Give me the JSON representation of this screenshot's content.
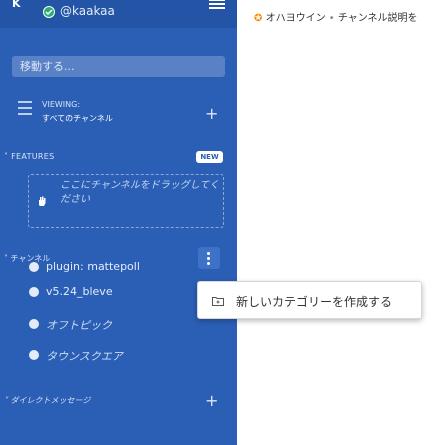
{
  "header": {
    "team_glyph": "K",
    "username": "@kaakaa",
    "channel_title": "オハヨウイン",
    "separator": "•",
    "channel_purpose": "チャンネル説明を"
  },
  "search": {
    "placeholder": "移動する..."
  },
  "viewing": {
    "label": "VIEWING:",
    "value": "すべてのチャンネル",
    "add_label": "+"
  },
  "features": {
    "title": "FEATURES",
    "badge": "NEW",
    "notice": "ここにチャンネルをドラッグしてください"
  },
  "channels": {
    "title": "チャンネル",
    "items": [
      {
        "label": "plugin: mattepoll",
        "italic": false
      },
      {
        "label": "v5.24_bleve",
        "italic": false
      },
      {
        "label": "オフトピック",
        "italic": true
      },
      {
        "label": "タウンスクエア",
        "italic": true
      }
    ]
  },
  "direct_messages": {
    "title": "ダイレクトメッセージ",
    "add_label": "+"
  },
  "context_menu": {
    "items": [
      {
        "label": "新しいカテゴリーを作成する"
      }
    ]
  },
  "colors": {
    "sidebar_bg": "#2b5fb6",
    "online": "#2bac76",
    "accent_star": "#ff8800"
  }
}
